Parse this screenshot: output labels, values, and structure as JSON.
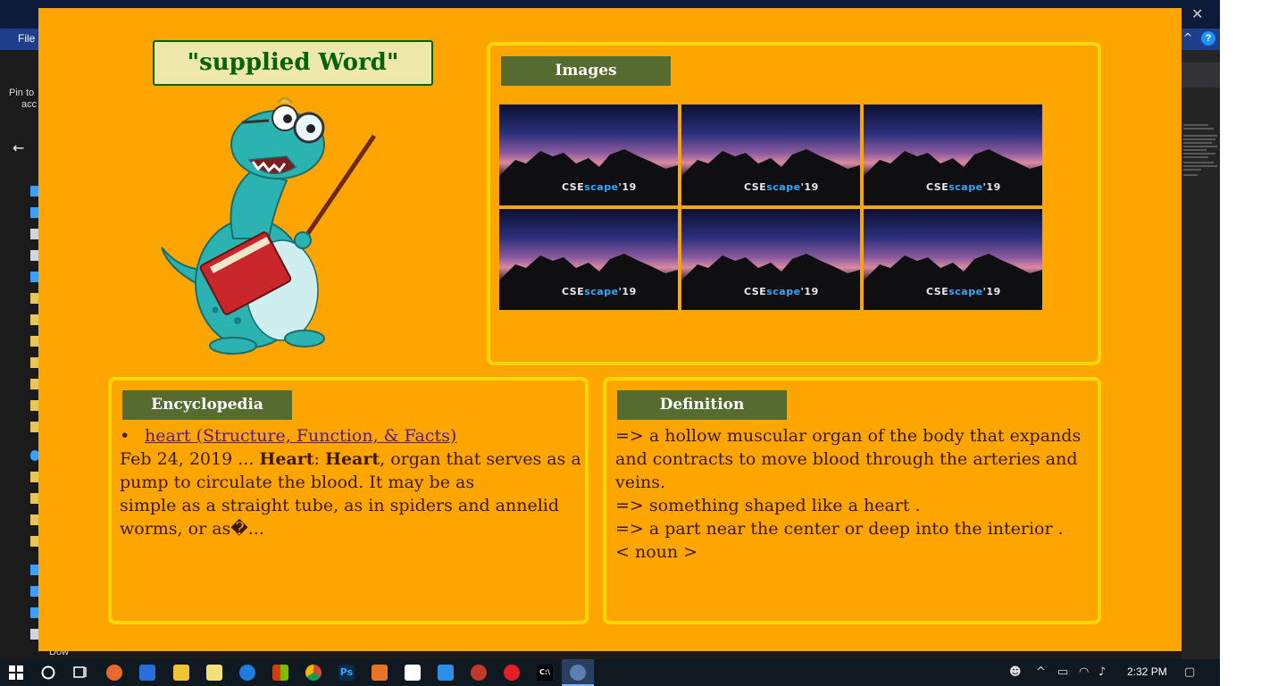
{
  "background_window": {
    "menu_file": "File",
    "pin_text_line1": "Pin to",
    "pin_text_line2": "acc",
    "back_arrow": "←",
    "downloads_label": "Dow",
    "close_glyph": "✕",
    "help_glyph": "?",
    "collapse_glyph": "^"
  },
  "app": {
    "supplied_word": "\"supplied Word\"",
    "images_panel": {
      "title": "Images",
      "thumbnails": [
        {
          "logo_prefix": "CS",
          "logo_mid": "E",
          "logo_accent": "scape",
          "logo_suffix": "'19"
        },
        {
          "logo_prefix": "CS",
          "logo_mid": "E",
          "logo_accent": "scape",
          "logo_suffix": "'19"
        },
        {
          "logo_prefix": "CS",
          "logo_mid": "E",
          "logo_accent": "scape",
          "logo_suffix": "'19"
        },
        {
          "logo_prefix": "CS",
          "logo_mid": "E",
          "logo_accent": "scape",
          "logo_suffix": "'19"
        },
        {
          "logo_prefix": "CS",
          "logo_mid": "E",
          "logo_accent": "scape",
          "logo_suffix": "'19"
        },
        {
          "logo_prefix": "CS",
          "logo_mid": "E",
          "logo_accent": "scape",
          "logo_suffix": "'19"
        }
      ]
    },
    "encyclopedia_panel": {
      "title": "Encyclopedia",
      "bullet": "•",
      "link_text": "heart (Structure, Function, & Facts)",
      "snippet_date": "Feb 24, 2019 ... ",
      "snippet_bold1": "Heart",
      "snippet_colon": ": ",
      "snippet_bold2": "Heart",
      "snippet_rest1": ", organ that serves as a pump to circulate the blood. It may be as",
      "snippet_rest2": "simple as a straight tube, as in spiders and annelid worms, or as�..."
    },
    "definition_panel": {
      "title": "Definition",
      "lines": [
        "=> a hollow muscular organ of the body that expands and contracts to move blood through the arteries and veins.",
        "=> something shaped like a heart .",
        "=> a part near the center or deep into the interior .",
        "< noun >"
      ]
    }
  },
  "taskbar": {
    "clock": "2:32 PM",
    "icons": [
      "windows-start-icon",
      "cortana-icon",
      "task-view-icon",
      "firefox-icon",
      "store-icon",
      "file-explorer-icon",
      "notepad-icon",
      "edge-icon",
      "office-icon",
      "chrome-icon",
      "photoshop-icon",
      "matlab-icon",
      "mail-icon",
      "vscode-icon",
      "settings-app-icon",
      "opera-icon",
      "cmd-icon",
      "python-app-icon"
    ],
    "ps_label": "Ps",
    "cmd_label": "C:\\"
  },
  "colors": {
    "app_background": "#ffa500",
    "panel_border": "#ffd700",
    "tag_background": "#556b2f",
    "word_box_background": "#eee8aa",
    "word_text": "#006400",
    "link": "#551a8b"
  }
}
